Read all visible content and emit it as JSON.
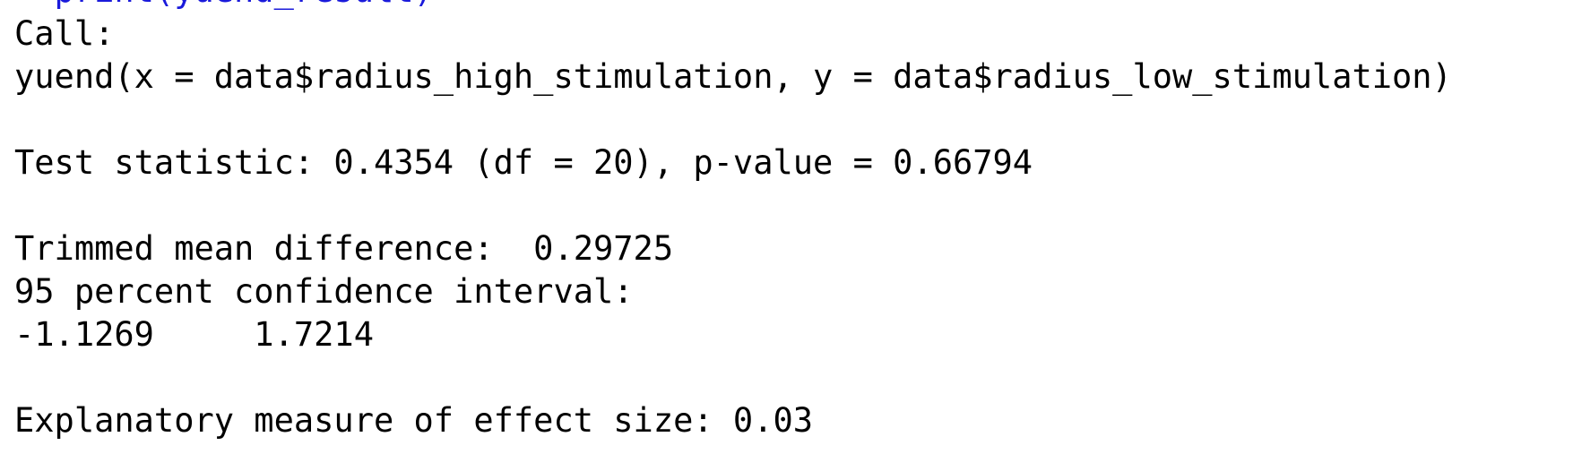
{
  "console": {
    "partial_command": "> print(yuend_result)",
    "call_header": "Call:",
    "call_expression": "yuend(x = data$radius_high_stimulation, y = data$radius_low_stimulation)",
    "test_statistic_line": "Test statistic: 0.4354 (df = 20), p-value = 0.66794",
    "trimmed_mean_line": "Trimmed mean difference:  0.29725",
    "ci_label": "95 percent confidence interval:",
    "ci_values": "-1.1269     1.7214",
    "effect_size_line": "Explanatory measure of effect size: 0.03"
  },
  "colors": {
    "command": "#1a1adb",
    "output": "#000000",
    "background": "#ffffff"
  }
}
